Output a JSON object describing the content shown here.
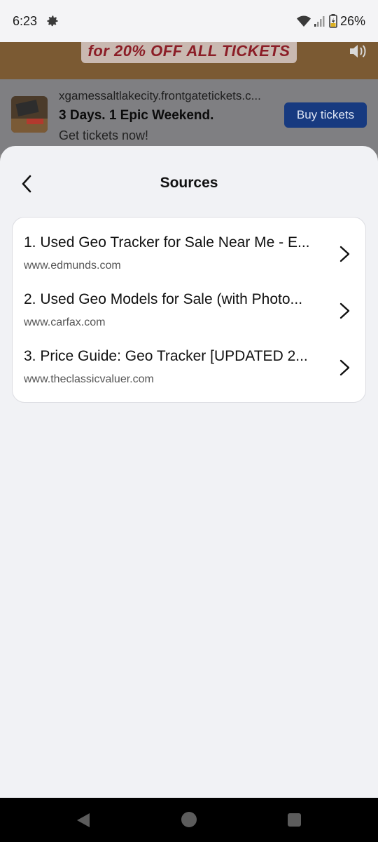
{
  "status_bar": {
    "time": "6:23",
    "battery_percent": "26%",
    "icons": [
      "settings-gear-icon",
      "wifi-icon",
      "cell-signal-icon",
      "battery-charging-icon"
    ]
  },
  "background_app": {
    "promo_text": "for 20% OFF ALL TICKETS",
    "ad": {
      "url": "xgamessaltlakecity.frontgatetickets.c...",
      "title": "3 Days. 1 Epic Weekend.",
      "subtitle": "Get tickets now!",
      "button_label": "Buy tickets"
    }
  },
  "sheet": {
    "title": "Sources",
    "items": [
      {
        "title": "1. Used Geo Tracker for Sale Near Me - E...",
        "domain": "www.edmunds.com"
      },
      {
        "title": "2. Used Geo Models for Sale (with Photo...",
        "domain": "www.carfax.com"
      },
      {
        "title": "3. Price Guide: Geo Tracker [UPDATED 2...",
        "domain": "www.theclassicvaluer.com"
      }
    ]
  },
  "colors": {
    "sheet_background": "#f1f2f5",
    "card_background": "#ffffff",
    "ad_button": "#173a80",
    "nav_bar": "#000000"
  }
}
